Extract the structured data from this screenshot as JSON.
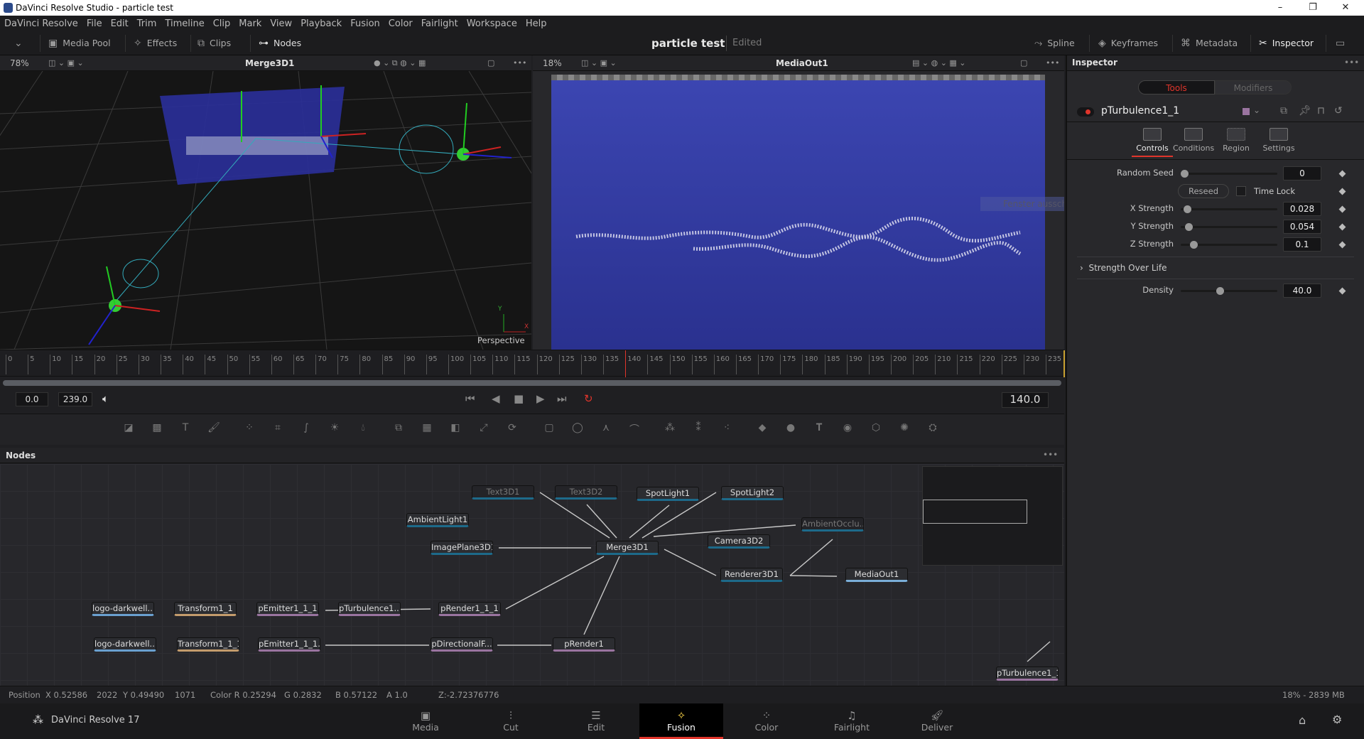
{
  "window": {
    "title": "DaVinci Resolve Studio - particle test",
    "minimize": "–",
    "restore": "❐",
    "close": "✕"
  },
  "menu": [
    "DaVinci Resolve",
    "File",
    "Edit",
    "Trim",
    "Timeline",
    "Clip",
    "Mark",
    "View",
    "Playback",
    "Fusion",
    "Color",
    "Fairlight",
    "Workspace",
    "Help"
  ],
  "toolbar": {
    "media_pool": "Media Pool",
    "effects": "Effects",
    "clips": "Clips",
    "nodes": "Nodes",
    "project": "particle test",
    "status": "Edited",
    "spline": "Spline",
    "keyframes": "Keyframes",
    "metadata": "Metadata",
    "inspector": "Inspector"
  },
  "viewer_left": {
    "zoom": "78%",
    "title": "Merge3D1",
    "view_label": "Perspective",
    "axis_y": "Y",
    "axis_x": "X"
  },
  "viewer_right": {
    "zoom": "18%",
    "title": "MediaOut1"
  },
  "tooltip": "Fenster ausschneiden",
  "inspector": {
    "title": "Inspector",
    "tabs": {
      "tools": "Tools",
      "modifiers": "Modifiers"
    },
    "node_name": "pTurbulence1_1",
    "node_color": "#9a74a0",
    "subtabs": [
      "Controls",
      "Conditions",
      "Region",
      "Settings"
    ],
    "active_subtab": "Controls",
    "random_seed": {
      "label": "Random Seed",
      "value": "0",
      "fraction": 0
    },
    "reseed": "Reseed",
    "time_lock": {
      "label": "Time Lock",
      "checked": false
    },
    "x_strength": {
      "label": "X Strength",
      "value": "0.028",
      "fraction": 0.03
    },
    "y_strength": {
      "label": "Y Strength",
      "value": "0.054",
      "fraction": 0.05
    },
    "z_strength": {
      "label": "Z Strength",
      "value": "0.1",
      "fraction": 0.1
    },
    "strength_over_life": "Strength Over Life",
    "density": {
      "label": "Density",
      "value": "40.0",
      "fraction": 0.4
    }
  },
  "timeline": {
    "start": 0,
    "end": 235,
    "step": 5,
    "playhead": 140,
    "in": "0.0",
    "out": "239.0",
    "current": "140.0"
  },
  "nodes_panel": {
    "title": "Nodes",
    "nodes": [
      "Text3D1",
      "Text3D2",
      "SpotLight1",
      "SpotLight2",
      "AmbientLight1",
      "ImagePlane3D1",
      "Merge3D1",
      "Camera3D2",
      "AmbientOcclu...",
      "Renderer3D1",
      "MediaOut1",
      "logo-darkwell...",
      "Transform1_1",
      "pEmitter1_1_1",
      "pTurbulence1...",
      "pRender1_1_1",
      "logo-darkwell...",
      "Transform1_1_1",
      "pEmitter1_1_1...",
      "pDirectionalF...",
      "pRender1",
      "pTurbulence1_1"
    ]
  },
  "status": {
    "position": "Position",
    "x": "X 0.52586",
    "xpx": "2022",
    "y": "Y 0.49490",
    "ypx": "1071",
    "color": "Color R 0.25294",
    "g": "G 0.2832",
    "b": "B 0.57122",
    "a": "A 1.0",
    "z": "Z:-2.72376776",
    "memory": "18% - 2839 MB"
  },
  "pages": {
    "app": "DaVinci Resolve 17",
    "items": [
      "Media",
      "Cut",
      "Edit",
      "Fusion",
      "Color",
      "Fairlight",
      "Deliver"
    ],
    "active": "Fusion"
  }
}
